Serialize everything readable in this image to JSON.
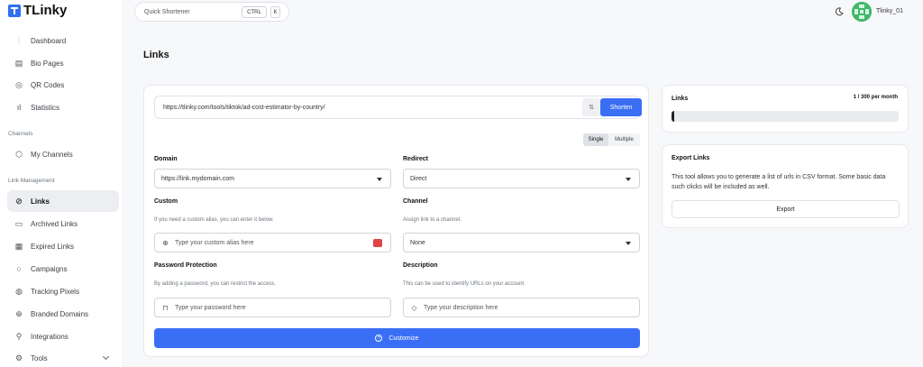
{
  "app": {
    "brand": "TLinky"
  },
  "sidebar": {
    "items_top": [
      {
        "label": "Dashboard",
        "icon": "sliders-icon"
      },
      {
        "label": "Bio Pages",
        "icon": "layout-icon"
      },
      {
        "label": "QR Codes",
        "icon": "qr-icon"
      },
      {
        "label": "Statistics",
        "icon": "bar-chart-icon"
      }
    ],
    "section_channels": "Channels",
    "my_channels": "My Channels",
    "section_link_management": "Link Management",
    "items_links": [
      {
        "label": "Links",
        "icon": "link-icon",
        "active": true
      },
      {
        "label": "Archived Links",
        "icon": "archive-icon"
      },
      {
        "label": "Expired Links",
        "icon": "calendar-icon"
      },
      {
        "label": "Campaigns",
        "icon": "target-icon"
      },
      {
        "label": "Tracking Pixels",
        "icon": "pixel-icon"
      },
      {
        "label": "Branded Domains",
        "icon": "globe-icon"
      },
      {
        "label": "Integrations",
        "icon": "plug-icon"
      },
      {
        "label": "Tools",
        "icon": "tools-icon"
      }
    ]
  },
  "topbar": {
    "quick_shortener": "Quick Shortener",
    "kbd_ctrl": "CTRL",
    "kbd_k": "K",
    "username": "Tlinky_01"
  },
  "page": {
    "title": "Links"
  },
  "form": {
    "url_value": "https://tlinky.com/tools/tiktok/ad-cost-estimator-by-country/",
    "shorten_label": "Shorten",
    "mode_single": "Single",
    "mode_multiple": "Multiple",
    "domain_label": "Domain",
    "domain_value": "https://link.mydomain.com",
    "redirect_label": "Redirect",
    "redirect_value": "Direct",
    "custom_label": "Custom",
    "custom_help": "If you need a custom alias, you can enter it below.",
    "custom_placeholder": "Type your custom alias here",
    "channel_label": "Channel",
    "channel_help": "Assign link to a channel.",
    "channel_value": "None",
    "password_label": "Password Protection",
    "password_help": "By adding a password, you can restrict the access.",
    "password_placeholder": "Type your password here",
    "description_label": "Description",
    "description_help": "This can be used to identify URLs on your account.",
    "description_placeholder": "Type your description here",
    "customize_label": "Customize"
  },
  "links_card": {
    "title": "Links",
    "quota": "1 / 300 per month",
    "progress": 0.0033
  },
  "export_card": {
    "title": "Export Links",
    "description": "This tool allows you to generate a list of urls in CSV format. Some basic data such clicks will be included as well.",
    "button": "Export"
  },
  "colors": {
    "accent": "#3a6ff5",
    "badge": "#e04343",
    "avatar": "#3fb86a"
  }
}
